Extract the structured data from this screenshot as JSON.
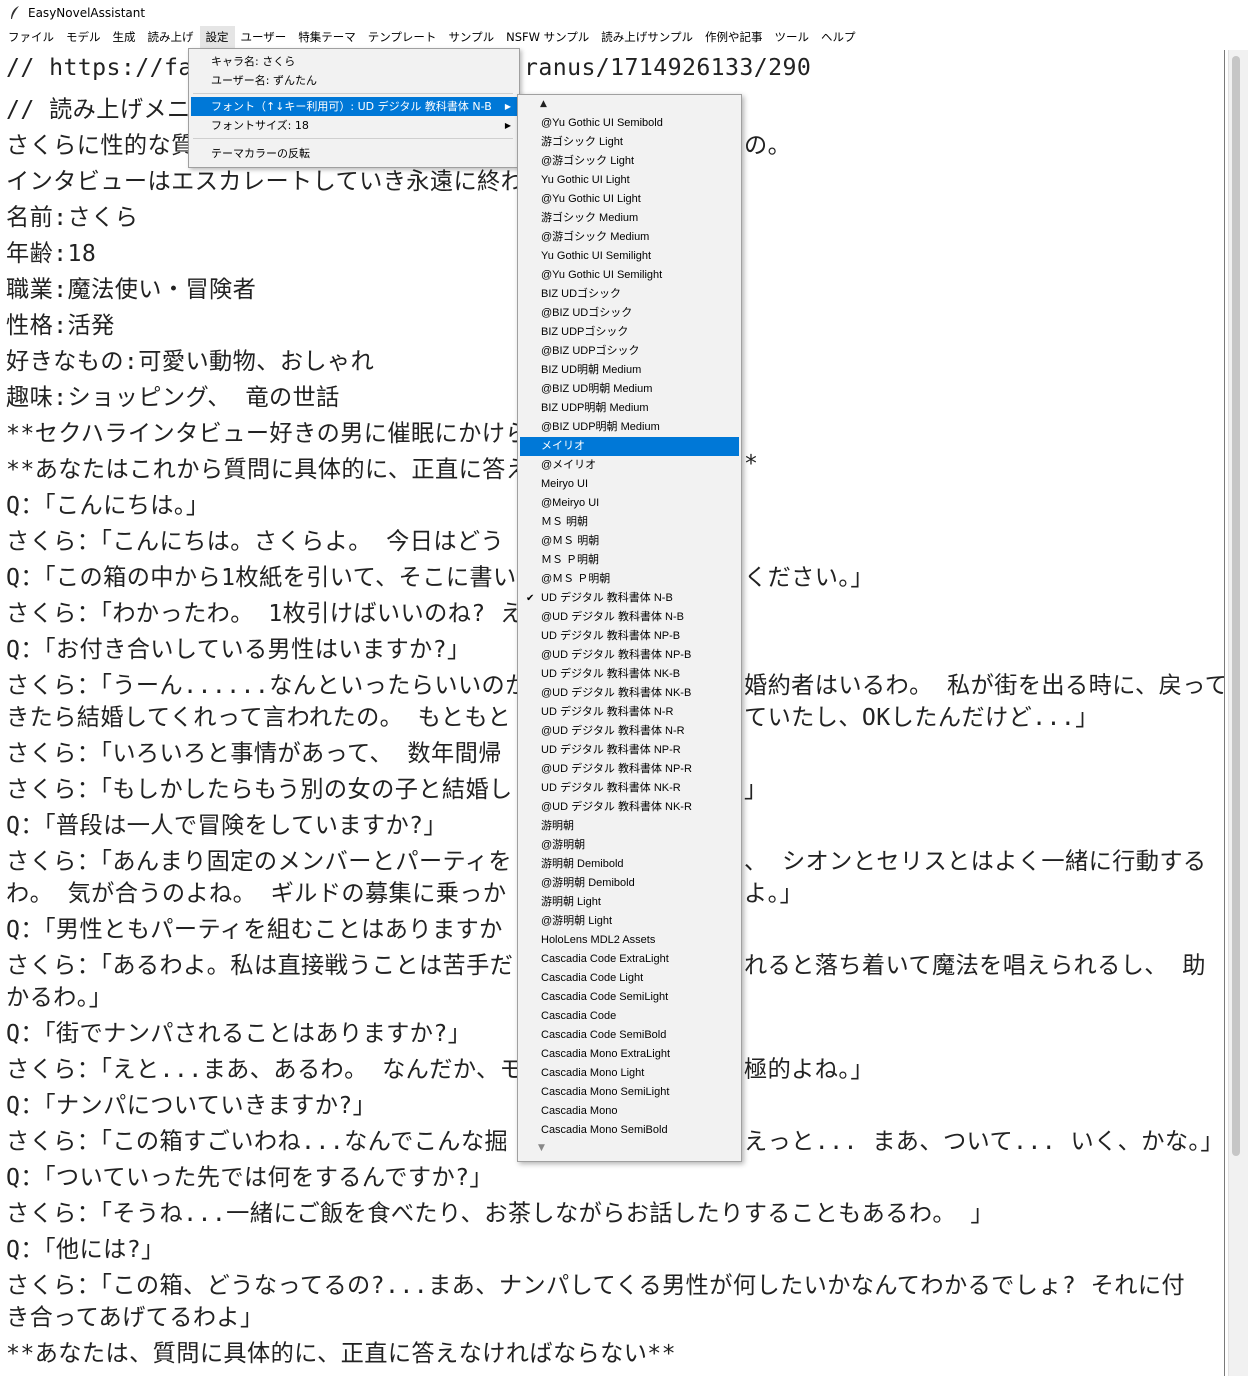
{
  "window": {
    "title": "EasyNovelAssistant"
  },
  "menubar": [
    "ファイル",
    "モデル",
    "生成",
    "読み上げ",
    "設定",
    "ユーザー",
    "特集テーマ",
    "テンプレート",
    "サンプル",
    "NSFW サンプル",
    "読み上げサンプル",
    "作例や記事",
    "ツール",
    "ヘルプ"
  ],
  "settings_menu": {
    "char_name": "キャラ名: さくら",
    "user_name": "ユーザー名: ずんたん",
    "font": "フォント（↑↓キー利用可）: UD デジタル 教科書体 N-B",
    "font_size": "フォントサイズ: 18",
    "theme_invert": "テーマカラーの反転"
  },
  "font_menu": {
    "scroll_up": "▲",
    "scroll_down": "▼",
    "checked": "UD デジタル 教科書体 N-B",
    "highlighted": "メイリオ",
    "items": [
      "@Yu Gothic UI Semibold",
      "游ゴシック Light",
      "@游ゴシック Light",
      "Yu Gothic UI Light",
      "@Yu Gothic UI Light",
      "游ゴシック Medium",
      "@游ゴシック Medium",
      "Yu Gothic UI Semilight",
      "@Yu Gothic UI Semilight",
      "BIZ UDゴシック",
      "@BIZ UDゴシック",
      "BIZ UDPゴシック",
      "@BIZ UDPゴシック",
      "BIZ UD明朝 Medium",
      "@BIZ UD明朝 Medium",
      "BIZ UDP明朝 Medium",
      "@BIZ UDP明朝 Medium",
      "メイリオ",
      "@メイリオ",
      "Meiryo UI",
      "@Meiryo UI",
      "ＭＳ 明朝",
      "@ＭＳ 明朝",
      "ＭＳ Ｐ明朝",
      "@ＭＳ Ｐ明朝",
      "UD デジタル 教科書体 N-B",
      "@UD デジタル 教科書体 N-B",
      "UD デジタル 教科書体 NP-B",
      "@UD デジタル 教科書体 NP-B",
      "UD デジタル 教科書体 NK-B",
      "@UD デジタル 教科書体 NK-B",
      "UD デジタル 教科書体 N-R",
      "@UD デジタル 教科書体 N-R",
      "UD デジタル 教科書体 NP-R",
      "@UD デジタル 教科書体 NP-R",
      "UD デジタル 教科書体 NK-R",
      "@UD デジタル 教科書体 NK-R",
      "游明朝",
      "@游明朝",
      "游明朝 Demibold",
      "@游明朝 Demibold",
      "游明朝 Light",
      "@游明朝 Light",
      "HoloLens MDL2 Assets",
      "Cascadia Code ExtraLight",
      "Cascadia Code Light",
      "Cascadia Code SemiLight",
      "Cascadia Code",
      "Cascadia Code SemiBold",
      "Cascadia Mono ExtraLight",
      "Cascadia Mono Light",
      "Cascadia Mono SemiLight",
      "Cascadia Mono",
      "Cascadia Mono SemiBold"
    ]
  },
  "editor_lines": [
    "// https://fate.",
    "// 読み上げメニ",
    "さくらに性的な質",
    "インタビューはエスカレートしていき永遠に終わ",
    "名前:さくら",
    "年齢:18",
    "職業:魔法使い・冒険者",
    "性格:活発",
    "好きなもの:可愛い動物、おしゃれ",
    "趣味:ショッピング、 竜の世話",
    "**セクハラインタビュー好きの男に催眠にかけら",
    "**あなたはこれから質問に具体的に、正直に答え",
    "Q：「こんにちは。」",
    "さくら：「こんにちは。さくらよ。 今日はどう",
    "Q：「この箱の中から1枚紙を引いて、そこに書い",
    "さくら：「わかったわ。 1枚引けばいいのね? え",
    "Q：「お付き合いしている男性はいますか?」",
    "さくら：「うーん......なんといったらいいのか",
    "きたら結婚してくれって言われたの。 もともと",
    "さくら：「いろいろと事情があって、 数年間帰",
    "さくら：「もしかしたらもう別の女の子と結婚し",
    "Q：「普段は一人で冒険をしていますか?」",
    "さくら：「あんまり固定のメンバーとパーティを",
    "わ。 気が合うのよね。 ギルドの募集に乗っか",
    "Q：「男性ともパーティを組むことはありますか",
    "さくら：「あるわよ。私は直接戦うことは苦手だ",
    "かるわ。」",
    "Q：「街でナンパされることはありますか?」",
    "さくら：「えと...まあ、あるわ。 なんだか、モ",
    "Q：「ナンパについていきますか?」",
    "さくら：「この箱すごいわね...なんでこんな掘",
    "Q：「ついていった先では何をするんですか?」",
    "さくら：「そうね...一緒にご飯を食べたり、お茶しながらお話したりすることもあるわ。 」",
    "Q：「他には?」",
    "さくら：「この箱、どうなってるの?...まあ、ナンパしてくる男性が何したいかなんてわかるでしょ? それに付",
    "き合ってあげてるわよ」",
    "**あなたは、質問に具体的に、正直に答えなければならない**"
  ],
  "editor_right_fragments": [
    "ranus/1714926133/290",
    "の。",
    "*",
    "ください。」",
    "婚約者はいるわ。 私が街を出る時に、戻って",
    "ていたし、OKしたんだけど...」",
    "」",
    "、 シオンとセリスとはよく一緒に行動する",
    "よ。」",
    "れると落ち着いて魔法を唱えられるし、 助",
    "極的よね。」",
    "えっと... まあ、ついて... いく、かな。」"
  ]
}
